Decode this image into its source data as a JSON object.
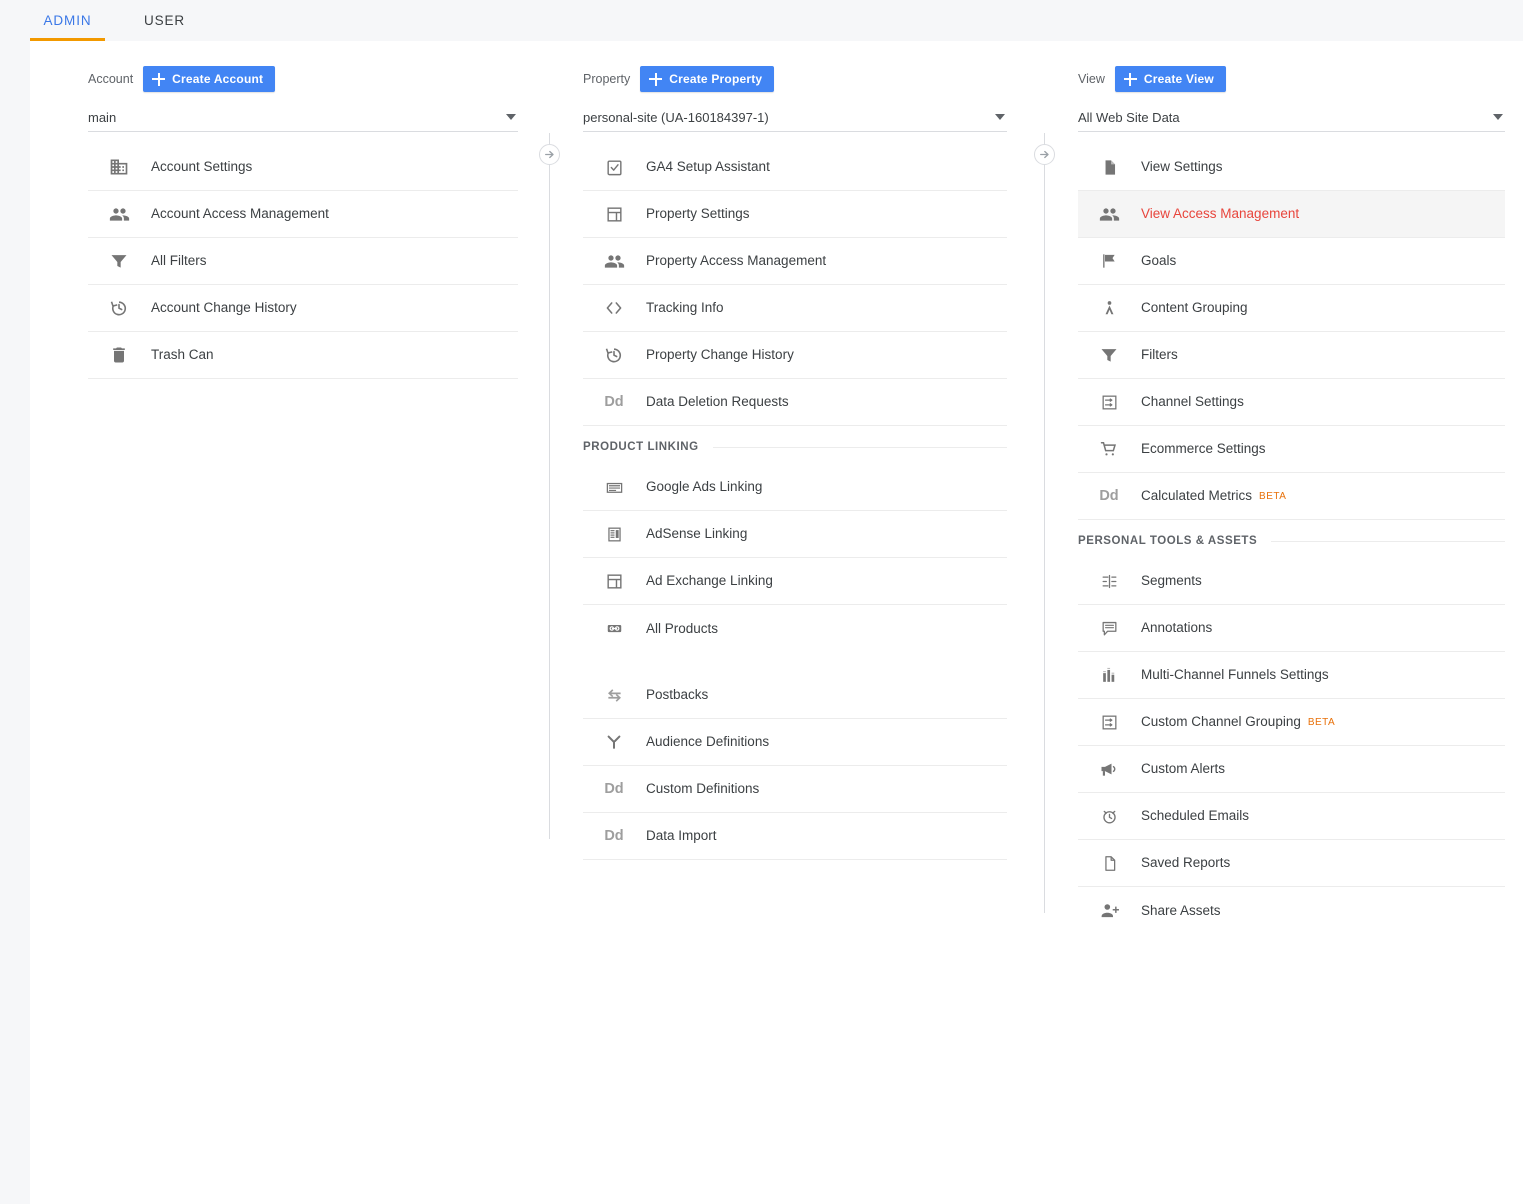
{
  "tabs": [
    {
      "label": "ADMIN",
      "name": "tab-admin",
      "active": true
    },
    {
      "label": "USER",
      "name": "tab-user",
      "active": false
    }
  ],
  "colors": {
    "accent_blue": "#4285f4",
    "tab_active_text": "#3b78e7",
    "tab_underline": "#f29900",
    "selected_item_text": "#e8453c",
    "selected_item_bg": "#f5f5f5",
    "beta_badge": "#e8710a",
    "icon_gray": "#757575",
    "divider": "#ececec"
  },
  "account_column": {
    "label": "Account",
    "create_button": "Create Account",
    "selected": "main",
    "items": [
      {
        "label": "Account Settings",
        "icon": "building-icon"
      },
      {
        "label": "Account Access Management",
        "icon": "people-icon"
      },
      {
        "label": "All Filters",
        "icon": "funnel-icon"
      },
      {
        "label": "Account Change History",
        "icon": "history-icon"
      },
      {
        "label": "Trash Can",
        "icon": "trash-icon"
      }
    ]
  },
  "property_column": {
    "label": "Property",
    "create_button": "Create Property",
    "selected": "personal-site (UA-160184397-1)",
    "items": [
      {
        "label": "GA4 Setup Assistant",
        "icon": "clipboard-check-icon"
      },
      {
        "label": "Property Settings",
        "icon": "layout-icon"
      },
      {
        "label": "Property Access Management",
        "icon": "people-icon"
      },
      {
        "label": "Tracking Info",
        "icon": "code-brackets-icon"
      },
      {
        "label": "Property Change History",
        "icon": "history-icon"
      },
      {
        "label": "Data Deletion Requests",
        "icon": "dd-icon"
      }
    ],
    "section_title": "PRODUCT LINKING",
    "linking_items": [
      {
        "label": "Google Ads Linking",
        "icon": "google-ads-icon"
      },
      {
        "label": "AdSense Linking",
        "icon": "adsense-icon"
      },
      {
        "label": "Ad Exchange Linking",
        "icon": "layout-icon"
      },
      {
        "label": "All Products",
        "icon": "link-icon"
      }
    ],
    "tail_items": [
      {
        "label": "Postbacks",
        "icon": "postbacks-icon"
      },
      {
        "label": "Audience Definitions",
        "icon": "audience-icon"
      },
      {
        "label": "Custom Definitions",
        "icon": "dd-icon"
      },
      {
        "label": "Data Import",
        "icon": "dd-icon"
      }
    ]
  },
  "view_column": {
    "label": "View",
    "create_button": "Create View",
    "selected": "All Web Site Data",
    "items": [
      {
        "label": "View Settings",
        "icon": "document-icon",
        "selected": false,
        "beta": ""
      },
      {
        "label": "View Access Management",
        "icon": "people-icon",
        "selected": true,
        "beta": ""
      },
      {
        "label": "Goals",
        "icon": "flag-icon",
        "selected": false,
        "beta": ""
      },
      {
        "label": "Content Grouping",
        "icon": "person-walking-icon",
        "selected": false,
        "beta": ""
      },
      {
        "label": "Filters",
        "icon": "funnel-icon",
        "selected": false,
        "beta": ""
      },
      {
        "label": "Channel Settings",
        "icon": "channel-icon",
        "selected": false,
        "beta": ""
      },
      {
        "label": "Ecommerce Settings",
        "icon": "cart-icon",
        "selected": false,
        "beta": ""
      },
      {
        "label": "Calculated Metrics",
        "icon": "dd-icon",
        "selected": false,
        "beta": "BETA"
      }
    ],
    "section_title": "PERSONAL TOOLS & ASSETS",
    "personal_items": [
      {
        "label": "Segments",
        "icon": "segments-icon",
        "beta": ""
      },
      {
        "label": "Annotations",
        "icon": "annotation-icon",
        "beta": ""
      },
      {
        "label": "Multi-Channel Funnels Settings",
        "icon": "bar-chart-icon",
        "beta": ""
      },
      {
        "label": "Custom Channel Grouping",
        "icon": "channel-icon",
        "beta": "BETA"
      },
      {
        "label": "Custom Alerts",
        "icon": "megaphone-icon",
        "beta": ""
      },
      {
        "label": "Scheduled Emails",
        "icon": "alarm-clock-icon",
        "beta": ""
      },
      {
        "label": "Saved Reports",
        "icon": "document-outline-icon",
        "beta": ""
      },
      {
        "label": "Share Assets",
        "icon": "person-add-icon",
        "beta": ""
      }
    ]
  },
  "dividers": [
    {
      "name": "divider-account-property",
      "arrow": "arrow-right-icon"
    },
    {
      "name": "divider-property-view",
      "arrow": "arrow-right-icon"
    }
  ]
}
